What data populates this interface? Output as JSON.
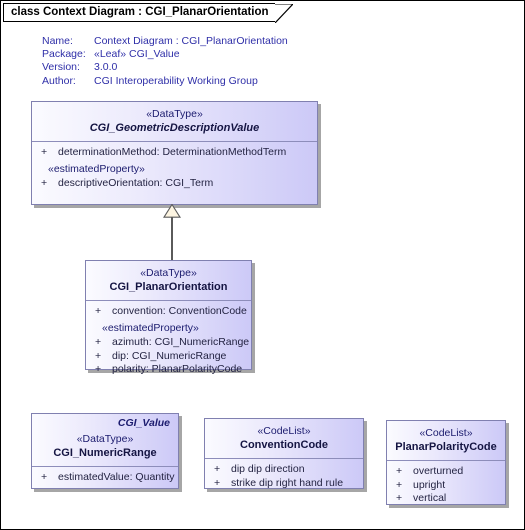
{
  "frame": {
    "title": "class Context Diagram : CGI_PlanarOrientation"
  },
  "metadata": [
    {
      "key": "Name:",
      "value": "Context Diagram : CGI_PlanarOrientation"
    },
    {
      "key": "Package:",
      "value": "«Leaf» CGI_Value"
    },
    {
      "key": "Version:",
      "value": "3.0.0"
    },
    {
      "key": "Author:",
      "value": "CGI Interoperability Working Group"
    }
  ],
  "classes": {
    "geometric_description_value": {
      "stereotype": "«DataType»",
      "name": "CGI_GeometricDescriptionValue",
      "attributes": [
        {
          "visibility": "+",
          "text": "determinationMethod: DeterminationMethodTerm"
        },
        {
          "visibility": "",
          "text": "«estimatedProperty»"
        },
        {
          "visibility": "+",
          "text": "descriptiveOrientation: CGI_Term"
        }
      ]
    },
    "planar_orientation": {
      "stereotype": "«DataType»",
      "name": "CGI_PlanarOrientation",
      "attributes": [
        {
          "visibility": "+",
          "text": "convention: ConventionCode"
        },
        {
          "visibility": "",
          "text": "«estimatedProperty»"
        },
        {
          "visibility": "+",
          "text": "azimuth: CGI_NumericRange"
        },
        {
          "visibility": "+",
          "text": "dip: CGI_NumericRange"
        },
        {
          "visibility": "+",
          "text": "polarity: PlanarPolarityCode"
        }
      ]
    },
    "numeric_range": {
      "package": "CGI_Value",
      "stereotype": "«DataType»",
      "name": "CGI_NumericRange",
      "attributes": [
        {
          "visibility": "+",
          "text": "estimatedValue: Quantity"
        }
      ]
    },
    "convention_code": {
      "stereotype": "«CodeList»",
      "name": "ConventionCode",
      "attributes": [
        {
          "visibility": "+",
          "text": "dip dip direction"
        },
        {
          "visibility": "+",
          "text": "strike dip right hand rule"
        }
      ]
    },
    "planar_polarity_code": {
      "stereotype": "«CodeList»",
      "name": "PlanarPolarityCode",
      "attributes": [
        {
          "visibility": "+",
          "text": "overturned"
        },
        {
          "visibility": "+",
          "text": "upright"
        },
        {
          "visibility": "+",
          "text": "vertical"
        }
      ]
    }
  },
  "connectors": {
    "generalization": {
      "type": "generalization",
      "from": "CGI_PlanarOrientation",
      "to": "CGI_GeometricDescriptionValue"
    }
  },
  "colors": {
    "class_fill_light": "#fbfbff",
    "class_fill_dark": "#ccc9f7",
    "class_border": "#8080b0",
    "metadata_text": "#2f2fa8",
    "stereotype_text": "#1b1b6e",
    "attribute_text": "#232342",
    "connector_line": "#5a5a5a",
    "triangle_fill": "#fdf5e2",
    "shadow": "#969696"
  }
}
